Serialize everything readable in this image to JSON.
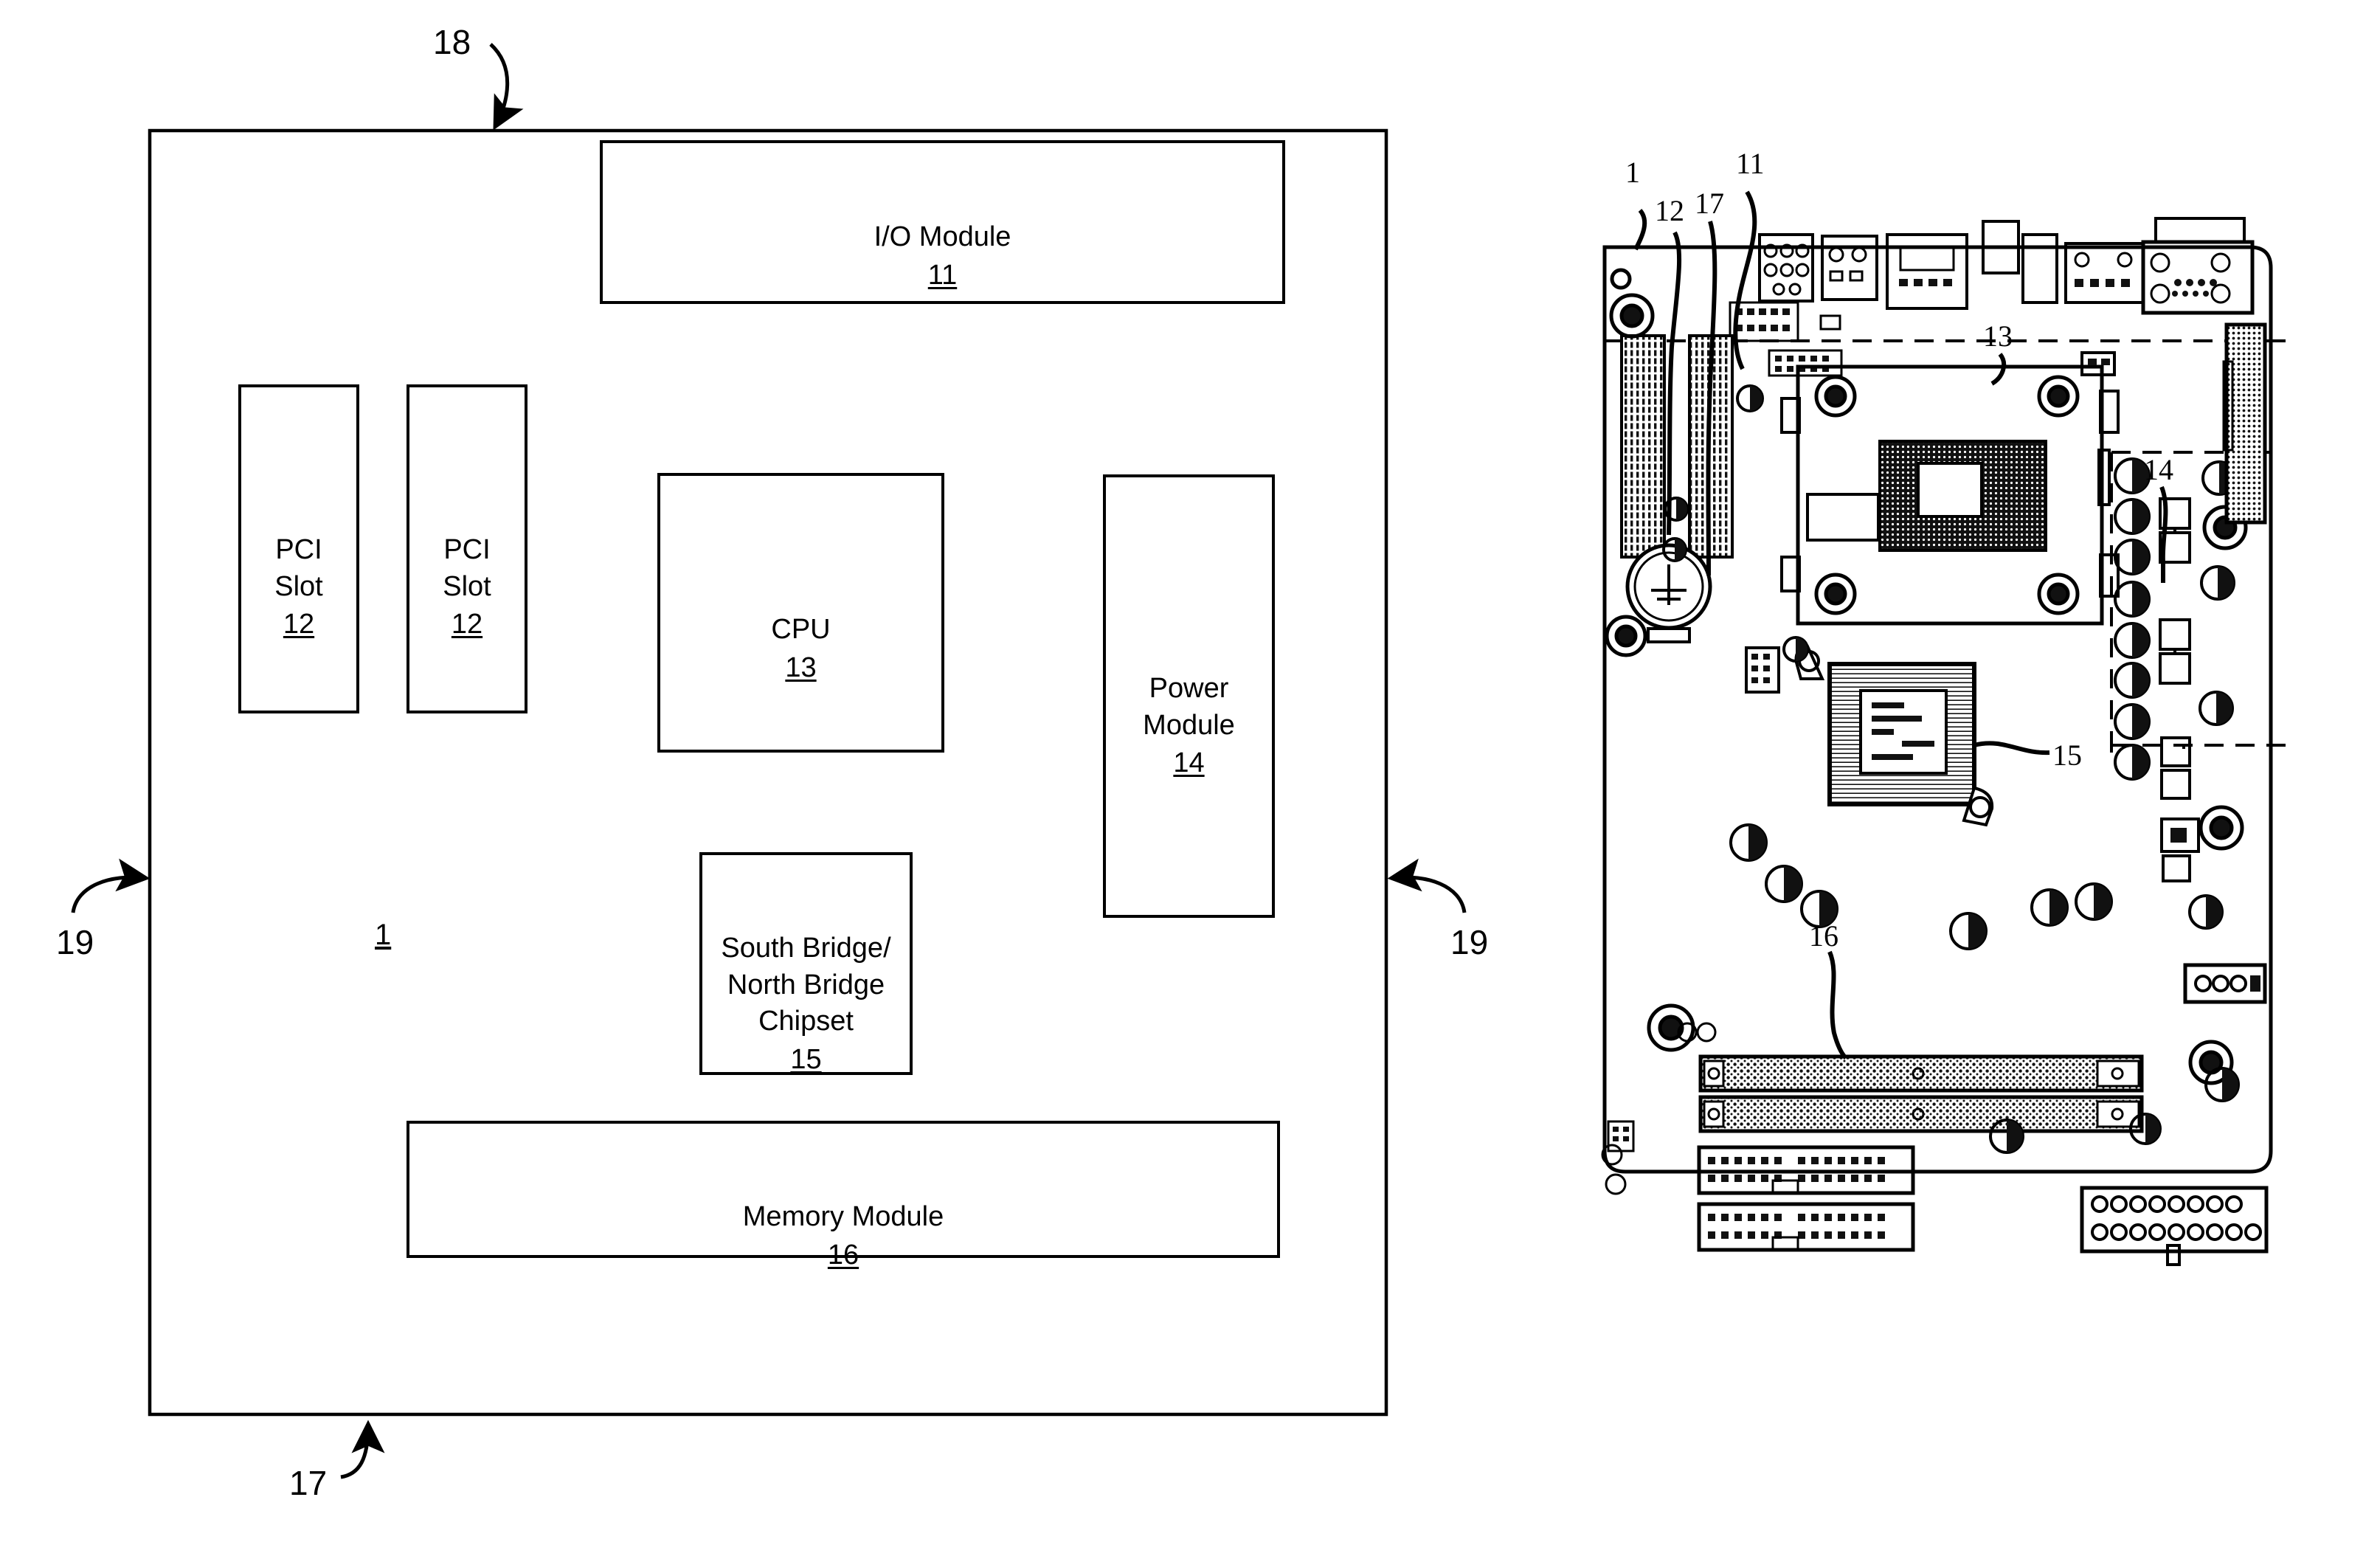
{
  "figure": {
    "title": "Motherboard block diagram and photograph",
    "line_color": "#000000",
    "background": "#ffffff"
  },
  "block_diagram": {
    "board_ref": "1",
    "top_edge_ref": "18",
    "bottom_edge_ref": "17",
    "side_ref_left": "19",
    "side_ref_right": "19",
    "blocks": [
      {
        "id": "io-module",
        "label": "I/O Module",
        "number": "11"
      },
      {
        "id": "pci-slot-1",
        "label": "PCI\nSlot",
        "number": "12"
      },
      {
        "id": "pci-slot-2",
        "label": "PCI\nSlot",
        "number": "12"
      },
      {
        "id": "cpu",
        "label": "CPU",
        "number": "13"
      },
      {
        "id": "power-module",
        "label": "Power\nModule",
        "number": "14"
      },
      {
        "id": "chipset",
        "label": "South Bridge/\nNorth Bridge\nChipset",
        "number": "15"
      },
      {
        "id": "memory-module",
        "label": "Memory Module",
        "number": "16"
      }
    ]
  },
  "photograph": {
    "caption": "motherboard-photograph",
    "callouts": [
      {
        "id": "callout-1",
        "number": "1"
      },
      {
        "id": "callout-12",
        "number": "12"
      },
      {
        "id": "callout-17",
        "number": "17"
      },
      {
        "id": "callout-11",
        "number": "11"
      },
      {
        "id": "callout-13",
        "number": "13"
      },
      {
        "id": "callout-14",
        "number": "14"
      },
      {
        "id": "callout-15",
        "number": "15"
      },
      {
        "id": "callout-16",
        "number": "16"
      }
    ]
  }
}
